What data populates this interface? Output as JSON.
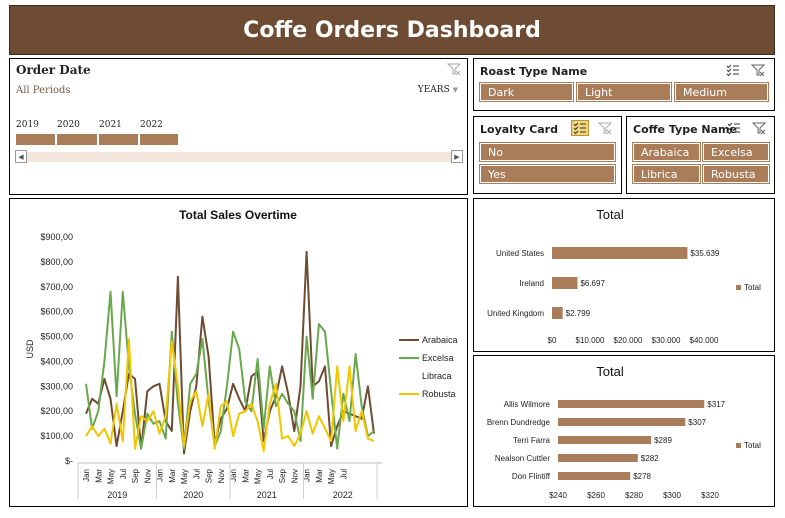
{
  "title": "Coffe Orders Dashboard",
  "order_date": {
    "title": "Order Date",
    "periods": "All Periods",
    "level": "YEARS",
    "years": [
      "2019",
      "2020",
      "2021",
      "2022"
    ]
  },
  "roast": {
    "title": "Roast Type Name",
    "items": [
      "Dark",
      "Light",
      "Medium"
    ]
  },
  "loyalty": {
    "title": "Loyalty Card",
    "items": [
      "No",
      "Yes"
    ]
  },
  "coffee_type": {
    "title": "Coffe Type Name",
    "items": [
      "Arabaica",
      "Excelsa",
      "Librica",
      "Robusta"
    ]
  },
  "colors": {
    "title_bg": "#6e4c33",
    "button": "#a97d5a",
    "bar": "#a97d5a",
    "arabaica": "#6e4c33",
    "excelsa": "#6aa84f",
    "librica": "#4f8fcf",
    "robusta": "#f2c600"
  },
  "chart_data": [
    {
      "type": "line",
      "title": "Total Sales Overtime",
      "ylabel": "USD",
      "ylim": [
        0,
        900
      ],
      "y_ticks": [
        "$-",
        "$100,00",
        "$200,00",
        "$300,00",
        "$400,00",
        "$500,00",
        "$600,00",
        "$700,00",
        "$800,00",
        "$900,00"
      ],
      "month_labels": [
        "Jan",
        "Mar",
        "May",
        "Jul",
        "Sep",
        "Nov",
        "Jan",
        "Mar",
        "May",
        "Jul",
        "Sep",
        "Nov",
        "Jan",
        "Mar",
        "May",
        "Jul",
        "Sep",
        "Nov",
        "Jan",
        "Mar",
        "May",
        "Jul"
      ],
      "year_labels": [
        "2019",
        "2020",
        "2021",
        "2022"
      ],
      "series": [
        {
          "name": "Arabaica",
          "values": [
            190,
            250,
            230,
            330,
            250,
            60,
            200,
            350,
            330,
            50,
            280,
            300,
            310,
            160,
            120,
            740,
            30,
            200,
            300,
            580,
            420,
            70,
            170,
            210,
            310,
            250,
            200,
            340,
            360,
            80,
            200,
            260,
            380,
            270,
            120,
            300,
            840,
            300,
            320,
            380,
            60,
            140,
            200,
            190,
            180,
            170,
            300,
            110
          ]
        },
        {
          "name": "Excelsa",
          "values": [
            310,
            130,
            200,
            400,
            680,
            260,
            680,
            380,
            190,
            50,
            190,
            150,
            160,
            90,
            520,
            230,
            50,
            310,
            350,
            490,
            240,
            60,
            120,
            300,
            520,
            450,
            240,
            200,
            410,
            130,
            380,
            220,
            270,
            230,
            200,
            80,
            500,
            250,
            550,
            520,
            280,
            50,
            270,
            160,
            430,
            220,
            100,
            120
          ]
        },
        {
          "name": "Libraca",
          "values": [
            170,
            430,
            350,
            220,
            530,
            170,
            190,
            200,
            170,
            300,
            110,
            220,
            270,
            340,
            60,
            110,
            470,
            160,
            220,
            310,
            140,
            60,
            400,
            170,
            270,
            350,
            90,
            320,
            420,
            40,
            170,
            240,
            130,
            320,
            80,
            130,
            320,
            130,
            580,
            560,
            100,
            370,
            840,
            130,
            170,
            190,
            270,
            20
          ]
        },
        {
          "name": "Robusta",
          "values": [
            100,
            140,
            100,
            130,
            70,
            230,
            80,
            490,
            50,
            180,
            160,
            200,
            110,
            180,
            480,
            300,
            60,
            240,
            280,
            140,
            270,
            50,
            220,
            240,
            100,
            190,
            200,
            230,
            160,
            40,
            230,
            310,
            90,
            100,
            60,
            110,
            200,
            110,
            180,
            130,
            80,
            380,
            160,
            380,
            120,
            200,
            90,
            80
          ]
        }
      ]
    },
    {
      "type": "bar",
      "title": "Total",
      "categories": [
        "United States",
        "Ireland",
        "United Kingdom"
      ],
      "values": [
        35639,
        6697,
        2799
      ],
      "value_labels": [
        "$35.639",
        "$6.697",
        "$2.799"
      ],
      "x_ticks": [
        "$0",
        "$10.000",
        "$20.000",
        "$30.000",
        "$40.000"
      ],
      "xlim": [
        0,
        40000
      ],
      "legend": "Total"
    },
    {
      "type": "bar",
      "title": "Total",
      "categories": [
        "Allis Wilmore",
        "Brenn Dundredge",
        "Terri Farra",
        "Nealson Cuttler",
        "Don Flintiff"
      ],
      "values": [
        317,
        307,
        289,
        282,
        278
      ],
      "value_labels": [
        "$317",
        "$307",
        "$289",
        "$282",
        "$278"
      ],
      "x_ticks": [
        "$240",
        "$260",
        "$280",
        "$300",
        "$320"
      ],
      "xlim": [
        240,
        320
      ],
      "legend": "Total"
    }
  ]
}
